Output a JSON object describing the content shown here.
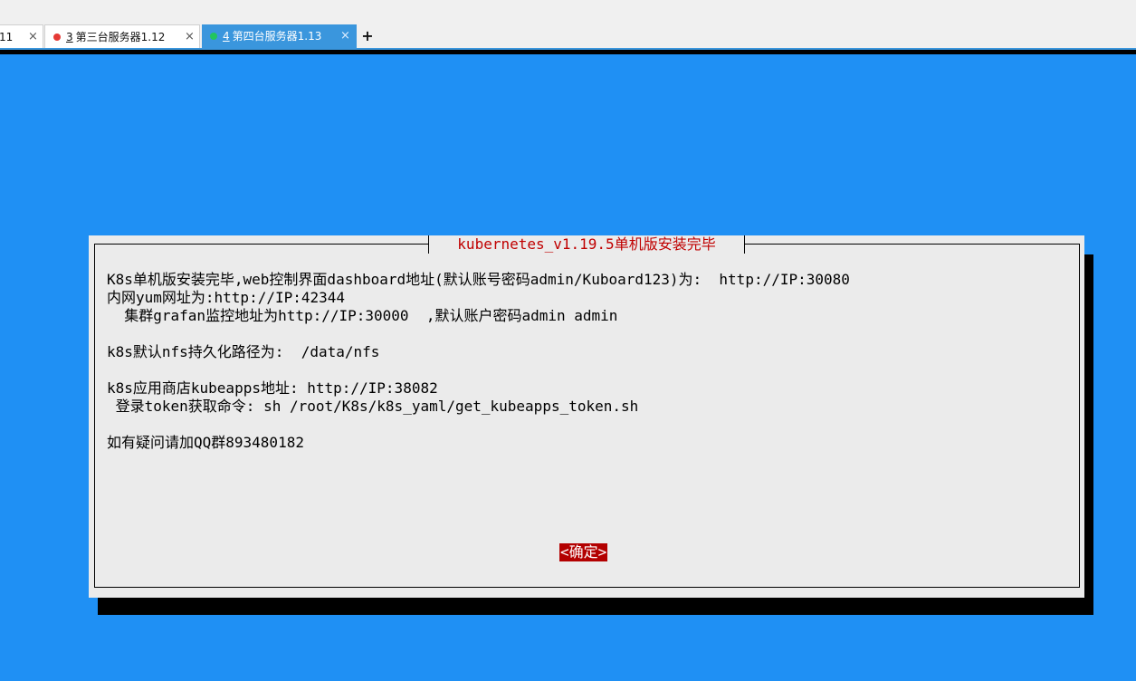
{
  "tabs": [
    {
      "label": "11",
      "close": "×",
      "active": false
    },
    {
      "number": "3",
      "label": "第三台服务器1.12",
      "close": "×",
      "dot_color": "#e53935",
      "active": false
    },
    {
      "number": "4",
      "label": "第四台服务器1.13",
      "close": "×",
      "dot_color": "#22c55e",
      "active": true
    }
  ],
  "new_tab_label": "+",
  "dialog": {
    "title": "kubernetes_v1.19.5单机版安装完毕",
    "lines": [
      "K8s单机版安装完毕,web控制界面dashboard地址(默认账号密码admin/Kuboard123)为:  http://IP:30080",
      "内网yum网址为:http://IP:42344",
      "  集群grafan监控地址为http://IP:30000  ,默认账户密码admin admin",
      "k8s默认nfs持久化路径为:  /data/nfs",
      "k8s应用商店kubeapps地址: http://IP:38082",
      " 登录token获取命令: sh /root/K8s/k8s_yaml/get_kubeapps_token.sh",
      "如有疑问请加QQ群893480182"
    ],
    "ok_button": "<确定>"
  },
  "colors": {
    "background": "#1f90f4",
    "dialog": "#ebebeb",
    "title_text": "#c00000",
    "button_bg": "#b30000",
    "active_tab": "#3a96dd"
  }
}
